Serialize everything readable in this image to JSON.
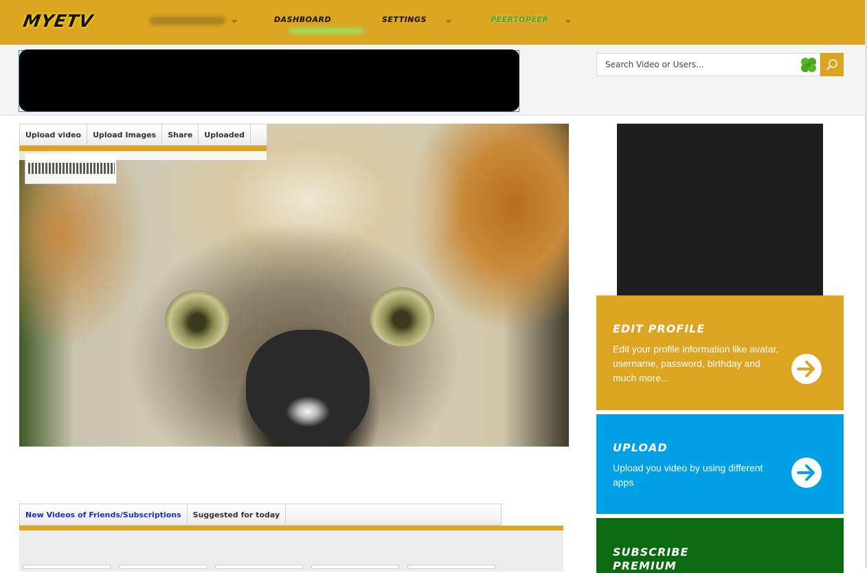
{
  "nav": {
    "logo": "MYETV",
    "items": [
      "DASHBOARD",
      "SETTINGS",
      "PEERTOPEER"
    ]
  },
  "search": {
    "placeholder": "Search Video or Users..."
  },
  "upload_tabs": [
    "Upload video",
    "Upload Images",
    "Share",
    "Uploaded"
  ],
  "feed_tabs": [
    "New Videos of Friends/Subscriptions",
    "Suggested for today"
  ],
  "cards": {
    "edit_profile": {
      "title": "EDIT PROFILE",
      "text": "Edit your profile information like avatar, username, password, birthday and much more..."
    },
    "upload": {
      "title": "UPLOAD",
      "text": "Upload you video by using different apps"
    },
    "premium": {
      "title": "SUBSCRIBE PREMIUM"
    }
  },
  "colors": {
    "brand": "#dba521",
    "upload_card": "#00a1e4",
    "premium_card": "#0a6b10",
    "active_tab": "#1a2fcf"
  },
  "icons": [
    "clover-icon",
    "search-icon",
    "arrow-right-icon",
    "chevron-down-icon"
  ]
}
